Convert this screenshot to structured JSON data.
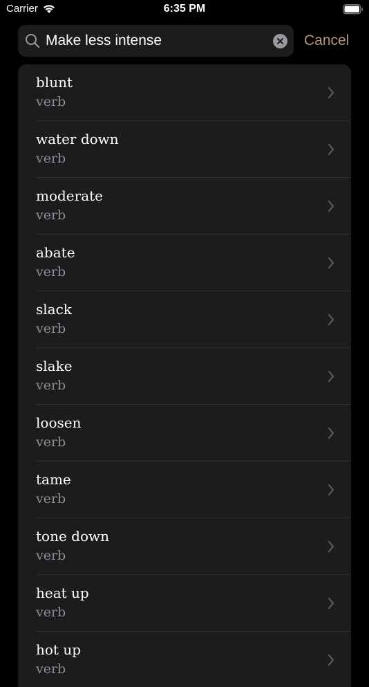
{
  "status_bar": {
    "carrier": "Carrier",
    "time": "6:35 PM"
  },
  "search": {
    "value": "Make less intense",
    "cancel_label": "Cancel"
  },
  "colors": {
    "accent": "#b8957a",
    "background": "#000000",
    "cell": "#1c1c1e",
    "secondary_text": "#8d8d92"
  },
  "results": [
    {
      "word": "blunt",
      "pos": "verb"
    },
    {
      "word": "water down",
      "pos": "verb"
    },
    {
      "word": "moderate",
      "pos": "verb"
    },
    {
      "word": "abate",
      "pos": "verb"
    },
    {
      "word": "slack",
      "pos": "verb"
    },
    {
      "word": "slake",
      "pos": "verb"
    },
    {
      "word": "loosen",
      "pos": "verb"
    },
    {
      "word": "tame",
      "pos": "verb"
    },
    {
      "word": "tone down",
      "pos": "verb"
    },
    {
      "word": "heat up",
      "pos": "verb"
    },
    {
      "word": "hot up",
      "pos": "verb"
    }
  ]
}
